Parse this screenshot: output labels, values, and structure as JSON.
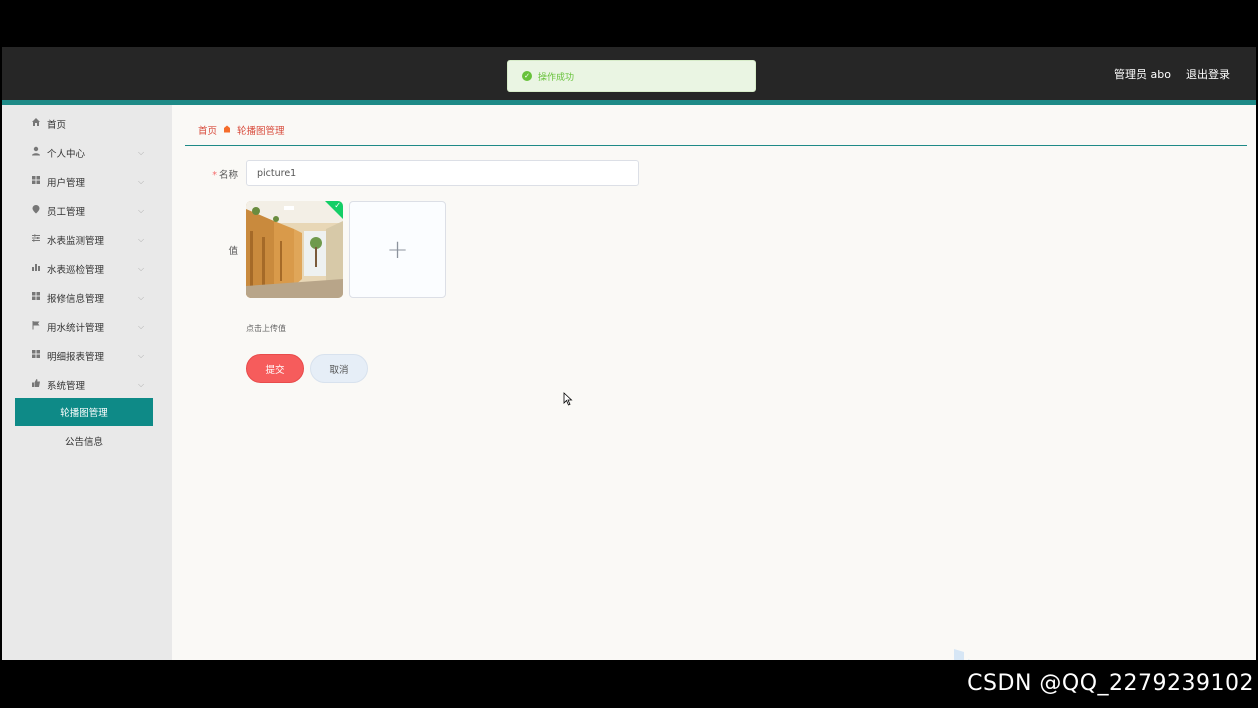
{
  "toast": {
    "message": "操作成功"
  },
  "header": {
    "user_label": "管理员 abo",
    "logout_label": "退出登录"
  },
  "sidebar": {
    "items": [
      {
        "label": "首页",
        "icon": "home-icon"
      },
      {
        "label": "个人中心",
        "icon": "user-icon"
      },
      {
        "label": "用户管理",
        "icon": "grid-icon"
      },
      {
        "label": "员工管理",
        "icon": "pin-icon"
      },
      {
        "label": "水表监测管理",
        "icon": "sliders-icon"
      },
      {
        "label": "水表巡检管理",
        "icon": "bar-chart-icon"
      },
      {
        "label": "报修信息管理",
        "icon": "grid-icon"
      },
      {
        "label": "用水统计管理",
        "icon": "flag-icon"
      },
      {
        "label": "明细报表管理",
        "icon": "grid-icon"
      },
      {
        "label": "系统管理",
        "icon": "thumb-up-icon"
      }
    ],
    "sub_items": [
      {
        "label": "轮播图管理",
        "active": true
      },
      {
        "label": "公告信息",
        "active": false
      }
    ]
  },
  "breadcrumb": {
    "home": "首页",
    "current": "轮播图管理"
  },
  "form": {
    "name_label": "名称",
    "name_value": "picture1",
    "value_label": "值",
    "upload_tip": "点击上传值",
    "submit_label": "提交",
    "cancel_label": "取消"
  },
  "watermark": "CSDN @QQ_2279239102",
  "colors": {
    "accent": "#0e8a87",
    "danger": "#f65c5c",
    "success": "#67c23a"
  }
}
